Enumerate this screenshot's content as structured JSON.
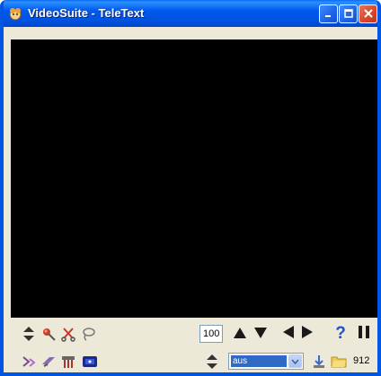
{
  "window": {
    "title": "VideoSuite - TeleText",
    "titlebar_color": "#0055e5",
    "video_background": "#000000"
  },
  "caption_buttons": {
    "minimize_icon": "minimize-icon",
    "maximize_icon": "maximize-icon",
    "close_icon": "close-icon"
  },
  "toolbar": {
    "row1_left_icons": [
      "updown-arrows-icon",
      "red-pin-icon",
      "scissors-icon",
      "lasso-icon"
    ],
    "page_number": "100",
    "nav_icons": [
      "arrow-up-icon",
      "arrow-down-icon",
      "arrow-left-icon",
      "arrow-right-icon",
      "help-icon",
      "pause-icon"
    ],
    "row2_left_icons": [
      "channel-icon",
      "capture-icon",
      "settings-icon",
      "tv-icon"
    ],
    "select_value": "aus",
    "row2_right_icons": [
      "save-icon",
      "folder-icon"
    ],
    "page_count": "912"
  }
}
